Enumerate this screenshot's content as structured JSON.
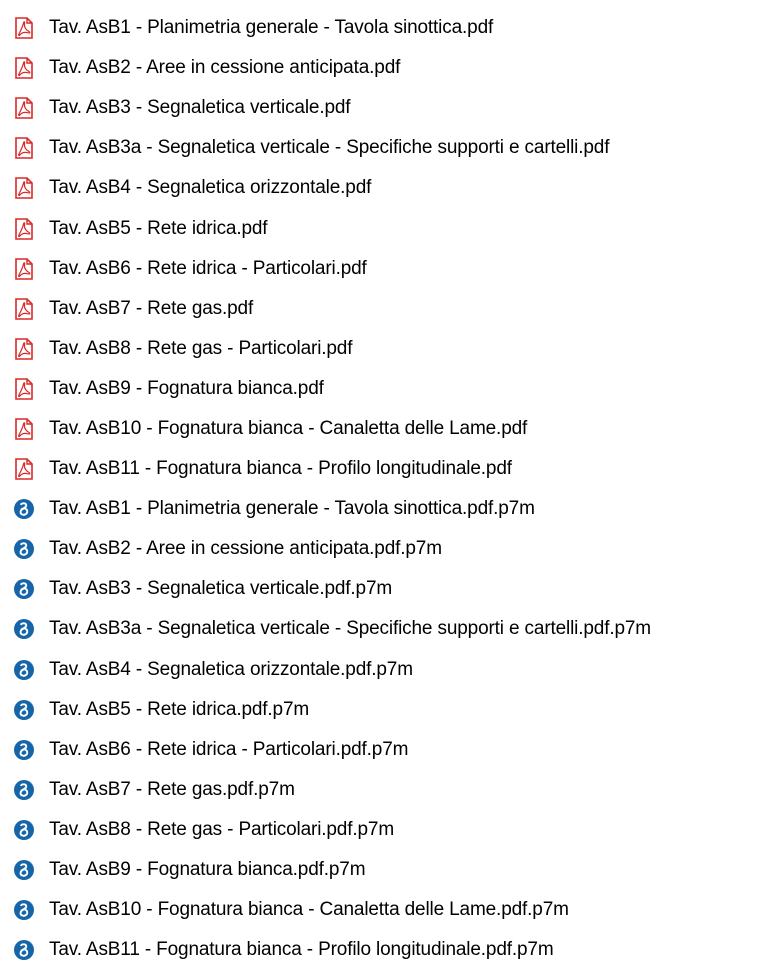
{
  "colors": {
    "pdf_icon_red": "#d92a2a",
    "signed_icon_blue": "#1565a8",
    "text": "#000000",
    "background": "#ffffff"
  },
  "files": [
    {
      "name": "Tav. AsB1 - Planimetria generale - Tavola sinottica.pdf",
      "icon": "pdf-icon"
    },
    {
      "name": "Tav. AsB2 - Aree in cessione anticipata.pdf",
      "icon": "pdf-icon"
    },
    {
      "name": "Tav. AsB3 - Segnaletica verticale.pdf",
      "icon": "pdf-icon"
    },
    {
      "name": "Tav. AsB3a - Segnaletica verticale - Specifiche supporti e cartelli.pdf",
      "icon": "pdf-icon"
    },
    {
      "name": "Tav. AsB4 - Segnaletica orizzontale.pdf",
      "icon": "pdf-icon"
    },
    {
      "name": "Tav. AsB5 - Rete idrica.pdf",
      "icon": "pdf-icon"
    },
    {
      "name": "Tav. AsB6 - Rete idrica - Particolari.pdf",
      "icon": "pdf-icon"
    },
    {
      "name": "Tav. AsB7 - Rete gas.pdf",
      "icon": "pdf-icon"
    },
    {
      "name": "Tav. AsB8 - Rete gas - Particolari.pdf",
      "icon": "pdf-icon"
    },
    {
      "name": "Tav. AsB9 - Fognatura bianca.pdf",
      "icon": "pdf-icon"
    },
    {
      "name": "Tav. AsB10 - Fognatura bianca - Canaletta delle Lame.pdf",
      "icon": "pdf-icon"
    },
    {
      "name": "Tav. AsB11 - Fognatura bianca - Profilo longitudinale.pdf",
      "icon": "pdf-icon"
    },
    {
      "name": "Tav. AsB1 - Planimetria generale - Tavola sinottica.pdf.p7m",
      "icon": "signed-file-icon"
    },
    {
      "name": "Tav. AsB2 - Aree in cessione anticipata.pdf.p7m",
      "icon": "signed-file-icon"
    },
    {
      "name": "Tav. AsB3 - Segnaletica verticale.pdf.p7m",
      "icon": "signed-file-icon"
    },
    {
      "name": "Tav. AsB3a - Segnaletica verticale - Specifiche supporti e cartelli.pdf.p7m",
      "icon": "signed-file-icon"
    },
    {
      "name": "Tav. AsB4 - Segnaletica orizzontale.pdf.p7m",
      "icon": "signed-file-icon"
    },
    {
      "name": "Tav. AsB5 - Rete idrica.pdf.p7m",
      "icon": "signed-file-icon"
    },
    {
      "name": "Tav. AsB6 - Rete idrica - Particolari.pdf.p7m",
      "icon": "signed-file-icon"
    },
    {
      "name": "Tav. AsB7 - Rete gas.pdf.p7m",
      "icon": "signed-file-icon"
    },
    {
      "name": "Tav. AsB8 - Rete gas - Particolari.pdf.p7m",
      "icon": "signed-file-icon"
    },
    {
      "name": "Tav. AsB9 - Fognatura bianca.pdf.p7m",
      "icon": "signed-file-icon"
    },
    {
      "name": "Tav. AsB10 - Fognatura bianca - Canaletta delle Lame.pdf.p7m",
      "icon": "signed-file-icon"
    },
    {
      "name": "Tav. AsB11 - Fognatura bianca - Profilo longitudinale.pdf.p7m",
      "icon": "signed-file-icon"
    }
  ]
}
